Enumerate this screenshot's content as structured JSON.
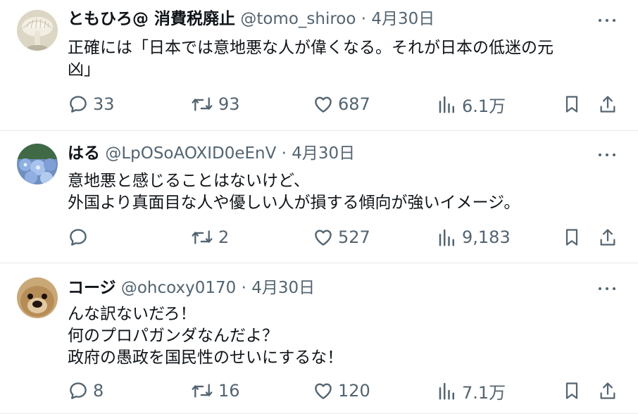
{
  "tweets": [
    {
      "display_name": "ともひろ@ 消費税廃止",
      "handle": "@tomo_shiroo",
      "date": "4月30日",
      "lines": [
        "正確には「日本では意地悪な人が偉くなる。それが日本の低迷の元",
        "凶」"
      ],
      "replies": "33",
      "reposts": "93",
      "likes": "687",
      "views": "6.1万"
    },
    {
      "display_name": "はる",
      "handle": "@LpOSoAOXID0eEnV",
      "date": "4月30日",
      "lines": [
        "意地悪と感じることはないけど、",
        "外国より真面目な人や優しい人が損する傾向が強いイメージ。"
      ],
      "replies": "",
      "reposts": "2",
      "likes": "527",
      "views": "9,183"
    },
    {
      "display_name": "コージ",
      "handle": "@ohcoxy0170",
      "date": "4月30日",
      "lines": [
        "んな訳ないだろ！",
        "何のプロパガンダなんだよ？",
        "政府の愚政を国民性のせいにするな！"
      ],
      "replies": "8",
      "reposts": "16",
      "likes": "120",
      "views": "7.1万"
    }
  ],
  "separator": "·",
  "colors": {
    "text": "#0f1419",
    "secondary": "#536471",
    "divider": "#e6e9ec"
  }
}
